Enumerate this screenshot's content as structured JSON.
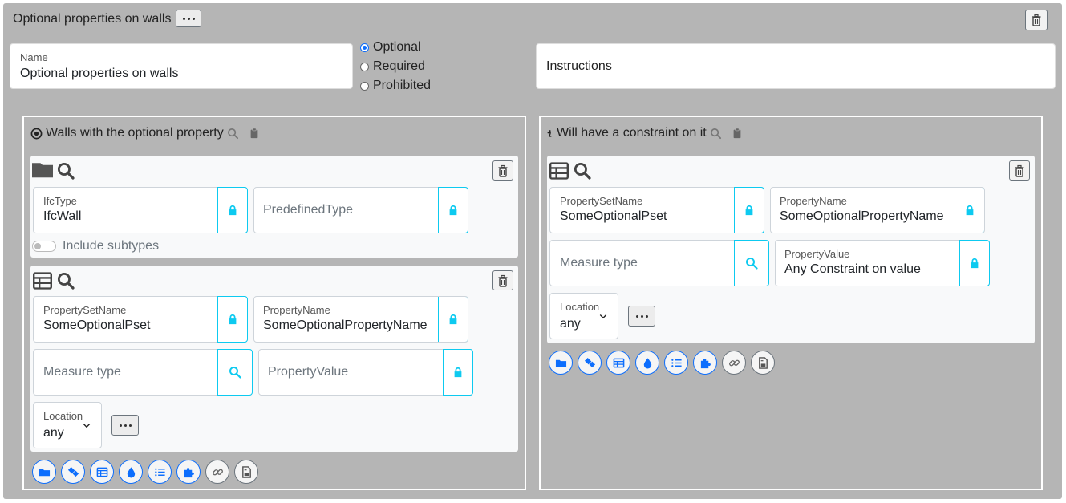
{
  "header": {
    "title": "Optional properties on walls",
    "more_icon": "ellipsis-icon",
    "delete_icon": "trash-icon"
  },
  "name_field": {
    "label": "Name",
    "value": "Optional properties on walls"
  },
  "cardinality": {
    "options": [
      "Optional",
      "Required",
      "Prohibited"
    ],
    "selected": "Optional"
  },
  "instructions": {
    "placeholder": "Instructions"
  },
  "applicability": {
    "title": "Walls with the optional property",
    "title_icon": "target-icon",
    "entity_facet": {
      "ifc_type": {
        "label": "IfcType",
        "value": "IfcWall"
      },
      "predefined_type": {
        "placeholder": "PredefinedType"
      },
      "include_subtypes": {
        "label": "Include subtypes",
        "checked": false
      }
    },
    "property_facet": {
      "pset_name": {
        "label": "PropertySetName",
        "value": "SomeOptionalPset"
      },
      "property_name": {
        "label": "PropertyName",
        "value": "SomeOptionalPropertyName"
      },
      "measure_type": {
        "placeholder": "Measure type"
      },
      "property_value": {
        "placeholder": "PropertyValue"
      },
      "location": {
        "label": "Location",
        "value": "any"
      }
    }
  },
  "requirements": {
    "title": "Will have a constraint on it",
    "title_icon": "info-icon",
    "property_facet": {
      "pset_name": {
        "label": "PropertySetName",
        "value": "SomeOptionalPset"
      },
      "property_name": {
        "label": "PropertyName",
        "value": "SomeOptionalPropertyName"
      },
      "measure_type": {
        "placeholder": "Measure type"
      },
      "property_value": {
        "label": "PropertyValue",
        "value": "Any Constraint on value"
      },
      "location": {
        "label": "Location",
        "value": "any"
      }
    }
  },
  "add_facet_buttons": [
    "folder-icon",
    "tags-icon",
    "table-icon",
    "droplet-icon",
    "list-icon",
    "puzzle-icon",
    "link-icon",
    "document-icon"
  ],
  "colors": {
    "accent": "#0d6efd",
    "addon_border": "#0dcaf0",
    "background": "#b5b5b5"
  }
}
